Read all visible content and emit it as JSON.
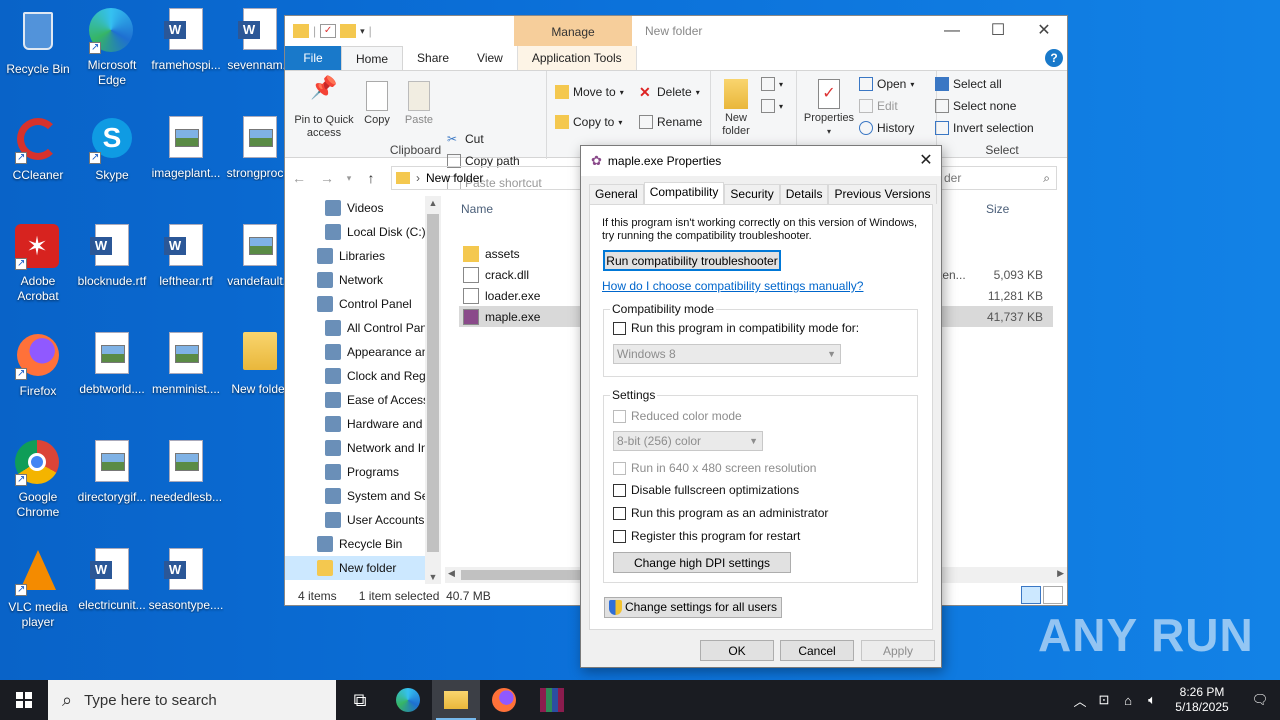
{
  "desktop": {
    "icons": [
      {
        "label": "Recycle Bin",
        "icon": "recycle-bin-icon"
      },
      {
        "label": "Microsoft Edge",
        "icon": "edge-icon"
      },
      {
        "label": "framehospi...",
        "icon": "word-doc-icon"
      },
      {
        "label": "sevennam...",
        "icon": "word-doc-icon"
      },
      {
        "label": "CCleaner",
        "icon": "ccleaner-icon"
      },
      {
        "label": "Skype",
        "icon": "skype-icon"
      },
      {
        "label": "imageplant...",
        "icon": "image-file-icon"
      },
      {
        "label": "strongproc...",
        "icon": "image-file-icon"
      },
      {
        "label": "Adobe Acrobat",
        "icon": "acrobat-icon"
      },
      {
        "label": "blocknude.rtf",
        "icon": "word-doc-icon"
      },
      {
        "label": "lefthear.rtf",
        "icon": "word-doc-icon"
      },
      {
        "label": "vandefault...",
        "icon": "image-file-icon"
      },
      {
        "label": "Firefox",
        "icon": "firefox-icon"
      },
      {
        "label": "debtworld....",
        "icon": "image-file-icon"
      },
      {
        "label": "menminist....",
        "icon": "image-file-icon"
      },
      {
        "label": "New folder",
        "icon": "folder-icon"
      },
      {
        "label": "Google Chrome",
        "icon": "chrome-icon"
      },
      {
        "label": "directorygif...",
        "icon": "image-file-icon"
      },
      {
        "label": "neededlesb...",
        "icon": "image-file-icon"
      },
      {
        "label": "VLC media player",
        "icon": "vlc-icon"
      },
      {
        "label": "electricunit...",
        "icon": "word-doc-icon"
      },
      {
        "label": "seasontype....",
        "icon": "word-doc-icon"
      }
    ]
  },
  "explorer": {
    "title": "New folder",
    "manage_tab": "Manage",
    "tabs": [
      "File",
      "Home",
      "Share",
      "View",
      "Application Tools"
    ],
    "clipboard": {
      "group_label": "Clipboard",
      "pin": "Pin to Quick access",
      "copy": "Copy",
      "paste": "Paste",
      "cut": "Cut",
      "copy_path": "Copy path",
      "paste_shortcut": "Paste shortcut"
    },
    "organize": {
      "move_to": "Move to",
      "copy_to": "Copy to",
      "delete": "Delete",
      "rename": "Rename"
    },
    "new": {
      "new_folder": "New folder"
    },
    "open": {
      "properties": "Properties",
      "open": "Open",
      "edit": "Edit",
      "history": "History"
    },
    "select": {
      "group_label": "Select",
      "select_all": "Select all",
      "select_none": "Select none",
      "invert": "Invert selection"
    },
    "address": "New folder",
    "search_placeholder": "der",
    "nav_items": [
      {
        "label": "Videos",
        "indent": 1
      },
      {
        "label": "Local Disk (C:)",
        "indent": 1
      },
      {
        "label": "Libraries",
        "indent": 0
      },
      {
        "label": "Network",
        "indent": 0
      },
      {
        "label": "Control Panel",
        "indent": 0
      },
      {
        "label": "All Control Pan",
        "indent": 1
      },
      {
        "label": "Appearance an",
        "indent": 1
      },
      {
        "label": "Clock and Regi",
        "indent": 1
      },
      {
        "label": "Ease of Access",
        "indent": 1
      },
      {
        "label": "Hardware and",
        "indent": 1
      },
      {
        "label": "Network and In",
        "indent": 1
      },
      {
        "label": "Programs",
        "indent": 1
      },
      {
        "label": "System and Sec",
        "indent": 1
      },
      {
        "label": "User Accounts",
        "indent": 1
      },
      {
        "label": "Recycle Bin",
        "indent": 0
      },
      {
        "label": "New folder",
        "indent": 0
      }
    ],
    "columns": {
      "name": "Name",
      "size": "Size"
    },
    "files": [
      {
        "name": "assets",
        "type_partial": "",
        "size": ""
      },
      {
        "name": "crack.dll",
        "type_partial": "ten...",
        "size": "5,093 KB"
      },
      {
        "name": "loader.exe",
        "type_partial": "",
        "size": "11,281 KB"
      },
      {
        "name": "maple.exe",
        "type_partial": "",
        "size": "41,737 KB"
      }
    ],
    "status": {
      "items": "4 items",
      "selected": "1 item selected",
      "size": "40.7 MB"
    }
  },
  "dialog": {
    "title": "maple.exe Properties",
    "tabs": [
      "General",
      "Compatibility",
      "Security",
      "Details",
      "Previous Versions"
    ],
    "intro": "If this program isn't working correctly on this version of Windows, try running the compatibility troubleshooter.",
    "troubleshooter_button": "Run compatibility troubleshooter",
    "manual_link": "How do I choose compatibility settings manually?",
    "compat_mode": {
      "legend": "Compatibility mode",
      "checkbox": "Run this program in compatibility mode for:",
      "os_select": "Windows 8"
    },
    "settings": {
      "legend": "Settings",
      "reduced_color": "Reduced color mode",
      "color_select": "8-bit (256) color",
      "run_640": "Run in 640 x 480 screen resolution",
      "disable_fullscreen": "Disable fullscreen optimizations",
      "run_admin": "Run this program as an administrator",
      "register_restart": "Register this program for restart",
      "dpi_button": "Change high DPI settings"
    },
    "all_users_button": "Change settings for all users",
    "ok": "OK",
    "cancel": "Cancel",
    "apply": "Apply"
  },
  "taskbar": {
    "search_placeholder": "Type here to search",
    "time": "8:26 PM",
    "date": "5/18/2025"
  },
  "watermark": "ANY RUN"
}
